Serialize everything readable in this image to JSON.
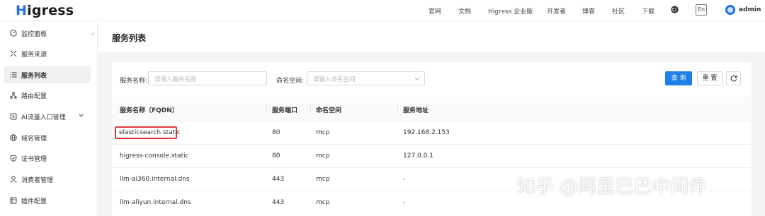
{
  "header": {
    "logo": "Higress",
    "nav": [
      "官网",
      "文档",
      "Higress 企业版",
      "开发者",
      "博客",
      "社区",
      "下载"
    ],
    "lang": "En",
    "user": "admin"
  },
  "sidebar": {
    "items": [
      {
        "label": "监控面板",
        "icon": "dashboard-icon"
      },
      {
        "label": "服务来源",
        "icon": "source-icon"
      },
      {
        "label": "服务列表",
        "icon": "list-icon",
        "active": true
      },
      {
        "label": "路由配置",
        "icon": "route-icon"
      },
      {
        "label": "AI流量入口管理",
        "icon": "ai-icon",
        "expandable": true
      },
      {
        "label": "域名管理",
        "icon": "globe-icon"
      },
      {
        "label": "证书管理",
        "icon": "shield-icon"
      },
      {
        "label": "消费者管理",
        "icon": "user-icon"
      },
      {
        "label": "插件配置",
        "icon": "plugin-icon"
      }
    ]
  },
  "page": {
    "title": "服务列表"
  },
  "filter": {
    "name_label": "服务名称:",
    "name_placeholder": "请输入服务名称",
    "namespace_label": "命名空间:",
    "namespace_placeholder": "请输入命名空间",
    "query_button": "查 询",
    "reset_button": "重 置"
  },
  "table": {
    "columns": [
      "服务名称（FQDN）",
      "服务端口",
      "命名空间",
      "服务地址"
    ],
    "rows": [
      [
        "elasticsearch.static",
        "80",
        "mcp",
        "192.168.2.153"
      ],
      [
        "higress-console.static",
        "80",
        "mcp",
        "127.0.0.1"
      ],
      [
        "llm-ai360.internal.dns",
        "443",
        "mcp",
        "-"
      ],
      [
        "llm-aliyun.internal.dns",
        "443",
        "mcp",
        "-"
      ]
    ]
  },
  "watermark": "知乎 @阿里巴巴中间件",
  "colors": {
    "accent": "#1f7fe8",
    "highlight": "#e0393e"
  }
}
